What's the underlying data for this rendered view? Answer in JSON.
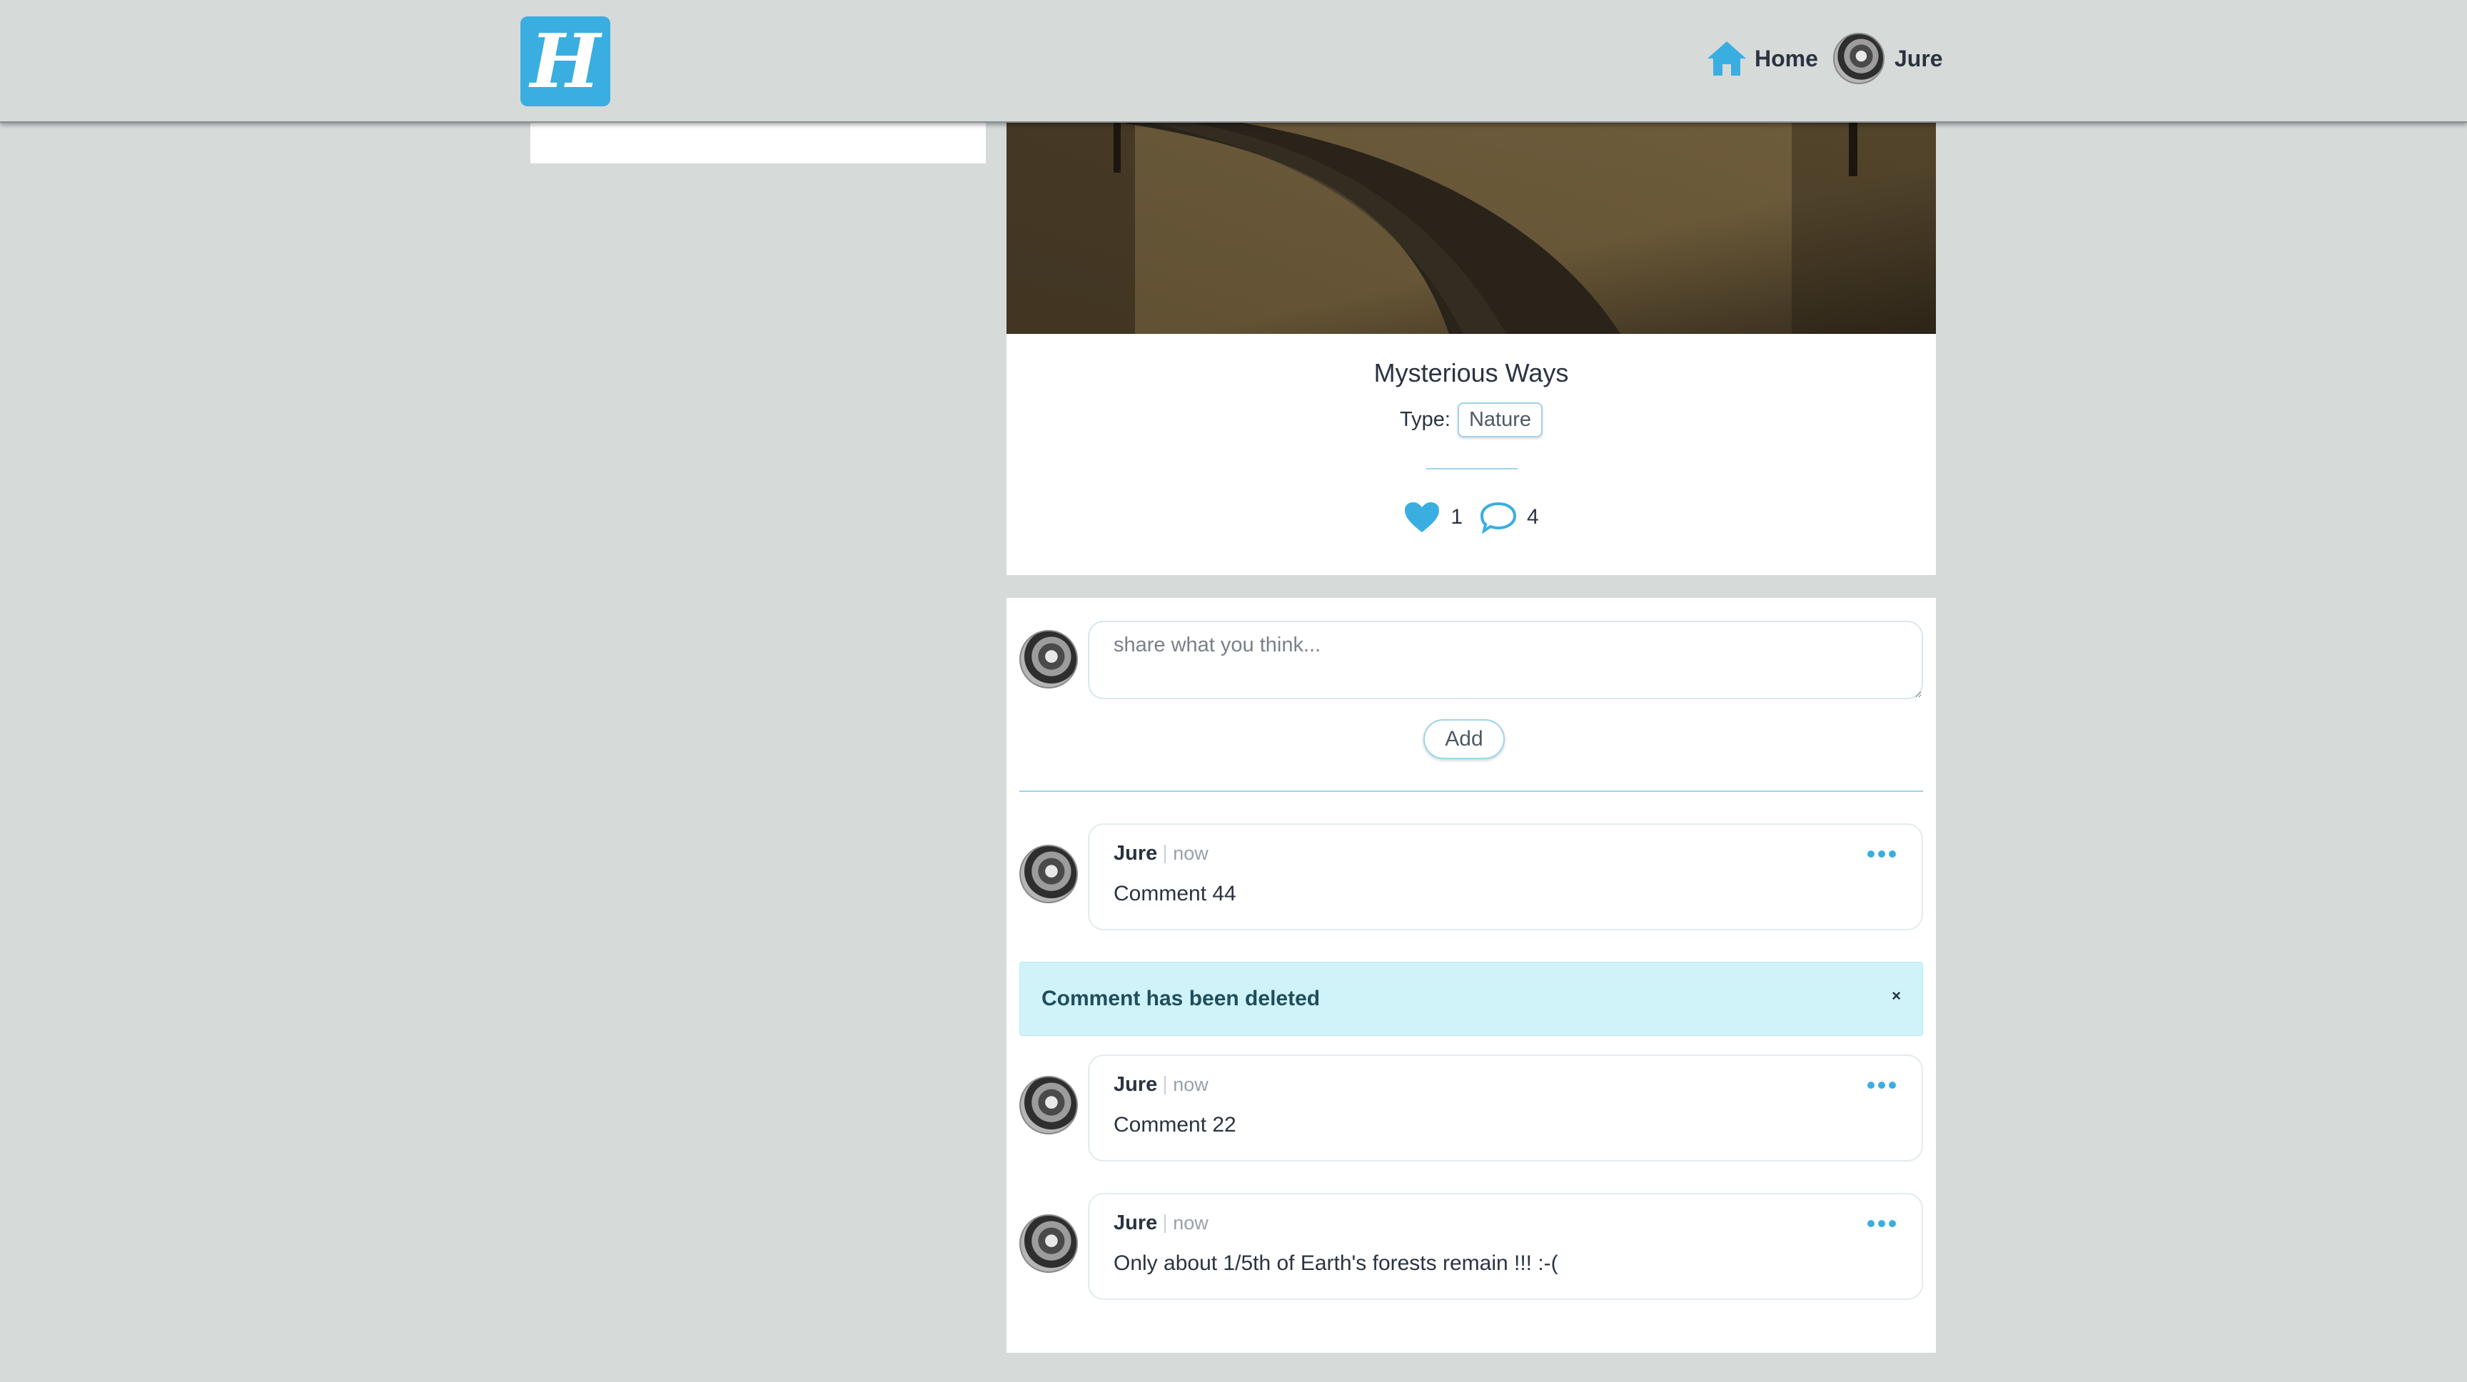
{
  "header": {
    "logo_letter": "H",
    "nav": {
      "home_label": "Home",
      "user_label": "Jure"
    }
  },
  "post": {
    "title": "Mysterious Ways",
    "type_label": "Type:",
    "type_value": "Nature",
    "likes": "1",
    "comments_count": "4"
  },
  "new_comment": {
    "placeholder": "share what you think...",
    "add_label": "Add"
  },
  "comments": [
    {
      "author": "Jure",
      "time": "now",
      "text": "Comment 44"
    },
    {
      "author": "Jure",
      "time": "now",
      "text": "Comment 22"
    },
    {
      "author": "Jure",
      "time": "now",
      "text": "Only about 1/5th of Earth's forests remain !!! :-("
    }
  ],
  "alert": {
    "message": "Comment has been deleted",
    "close_symbol": "×"
  },
  "colors": {
    "accent": "#3aaee0",
    "background": "#d6dbda",
    "alert_bg": "#cff3f9"
  },
  "icons": [
    "home-icon",
    "heart-icon",
    "comment-bubble-icon",
    "more-dots-icon",
    "close-icon"
  ]
}
